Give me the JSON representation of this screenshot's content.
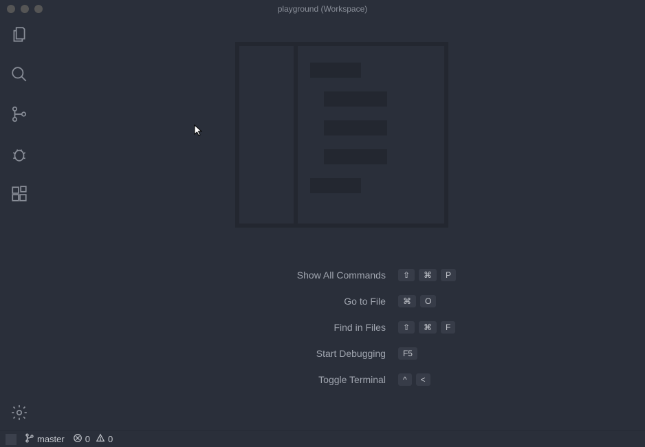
{
  "titlebar": {
    "title": "playground (Workspace)"
  },
  "activitybar": {
    "items": [
      {
        "name": "explorer"
      },
      {
        "name": "search"
      },
      {
        "name": "source-control"
      },
      {
        "name": "debug"
      },
      {
        "name": "extensions"
      }
    ],
    "settings": {
      "name": "manage"
    }
  },
  "shortcuts": [
    {
      "label": "Show All Commands",
      "keys": [
        "⇧",
        "⌘",
        "P"
      ]
    },
    {
      "label": "Go to File",
      "keys": [
        "⌘",
        "O"
      ]
    },
    {
      "label": "Find in Files",
      "keys": [
        "⇧",
        "⌘",
        "F"
      ]
    },
    {
      "label": "Start Debugging",
      "keys": [
        "F5"
      ]
    },
    {
      "label": "Toggle Terminal",
      "keys": [
        "^",
        "<"
      ]
    }
  ],
  "statusbar": {
    "branch": "master",
    "errors": "0",
    "warnings": "0"
  }
}
